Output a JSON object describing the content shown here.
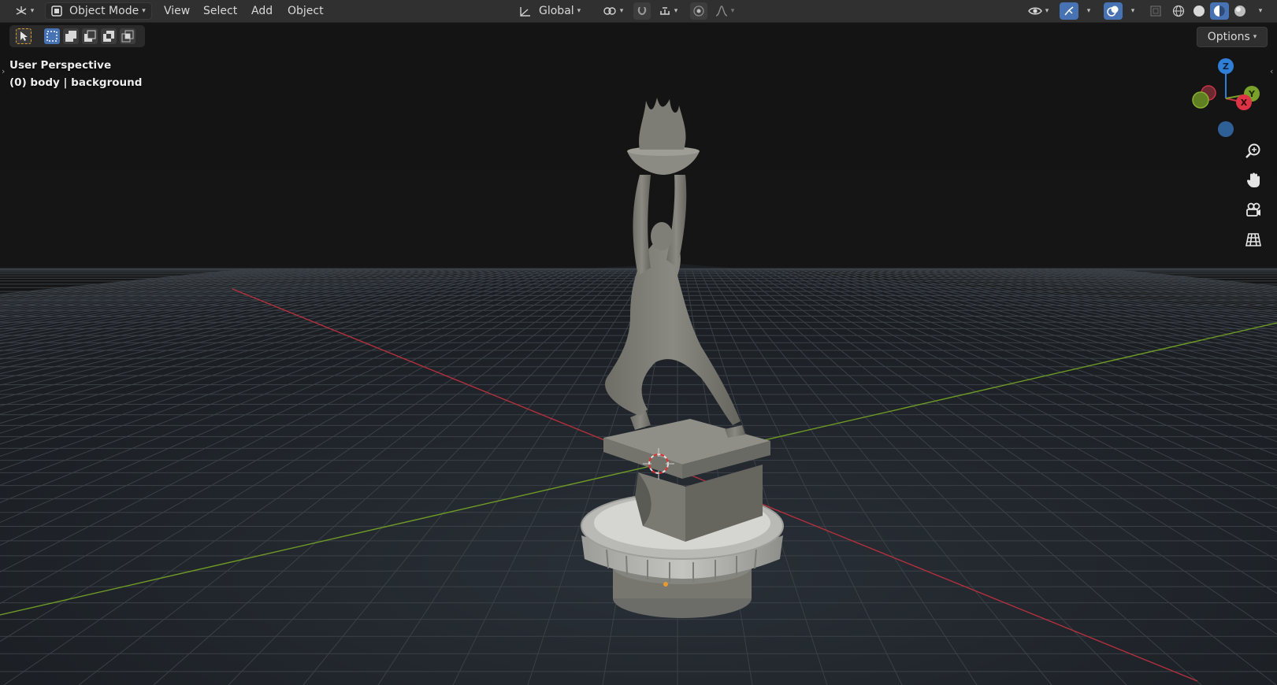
{
  "header": {
    "editor_type_icon": "view3d-icon",
    "mode": {
      "label": "Object Mode",
      "icon": "object-mode-icon"
    },
    "menus": [
      "View",
      "Select",
      "Add",
      "Object"
    ],
    "transform_orientation": {
      "label": "Global",
      "icon": "orientation-icon"
    },
    "pivot_icon": "pivot-icon",
    "snap_icon": "snap-icon",
    "snap_increment_icon": "snap-increment-icon",
    "proportional_icon": "proportional-edit-icon",
    "falloff_icon": "falloff-curve-icon",
    "visibility_icon": "visibility-eye-icon",
    "gizmo_icon": "gizmo-icon",
    "overlay_icon": "overlay-icon",
    "xray_icon": "xray-icon",
    "shading_modes": [
      "wireframe",
      "solid",
      "material-preview",
      "rendered"
    ],
    "active_shading": "material-preview"
  },
  "tool_settings": {
    "select_tool_icon": "select-cursor-icon",
    "select_modes": [
      "set",
      "extend",
      "subtract",
      "difference",
      "intersect"
    ]
  },
  "options_label": "Options",
  "overlay": {
    "perspective": "User Perspective",
    "collection": "(0) body | background"
  },
  "gizmo": {
    "z": "Z",
    "x": "X",
    "y": "Y"
  },
  "nav_icons": [
    "zoom-icon",
    "pan-hand-icon",
    "camera-icon",
    "grid-ortho-icon"
  ],
  "colors": {
    "axis_x": "#cc3344",
    "axis_y": "#7aa12a",
    "axis_z": "#2f7fd6",
    "accent": "#4772b3"
  }
}
